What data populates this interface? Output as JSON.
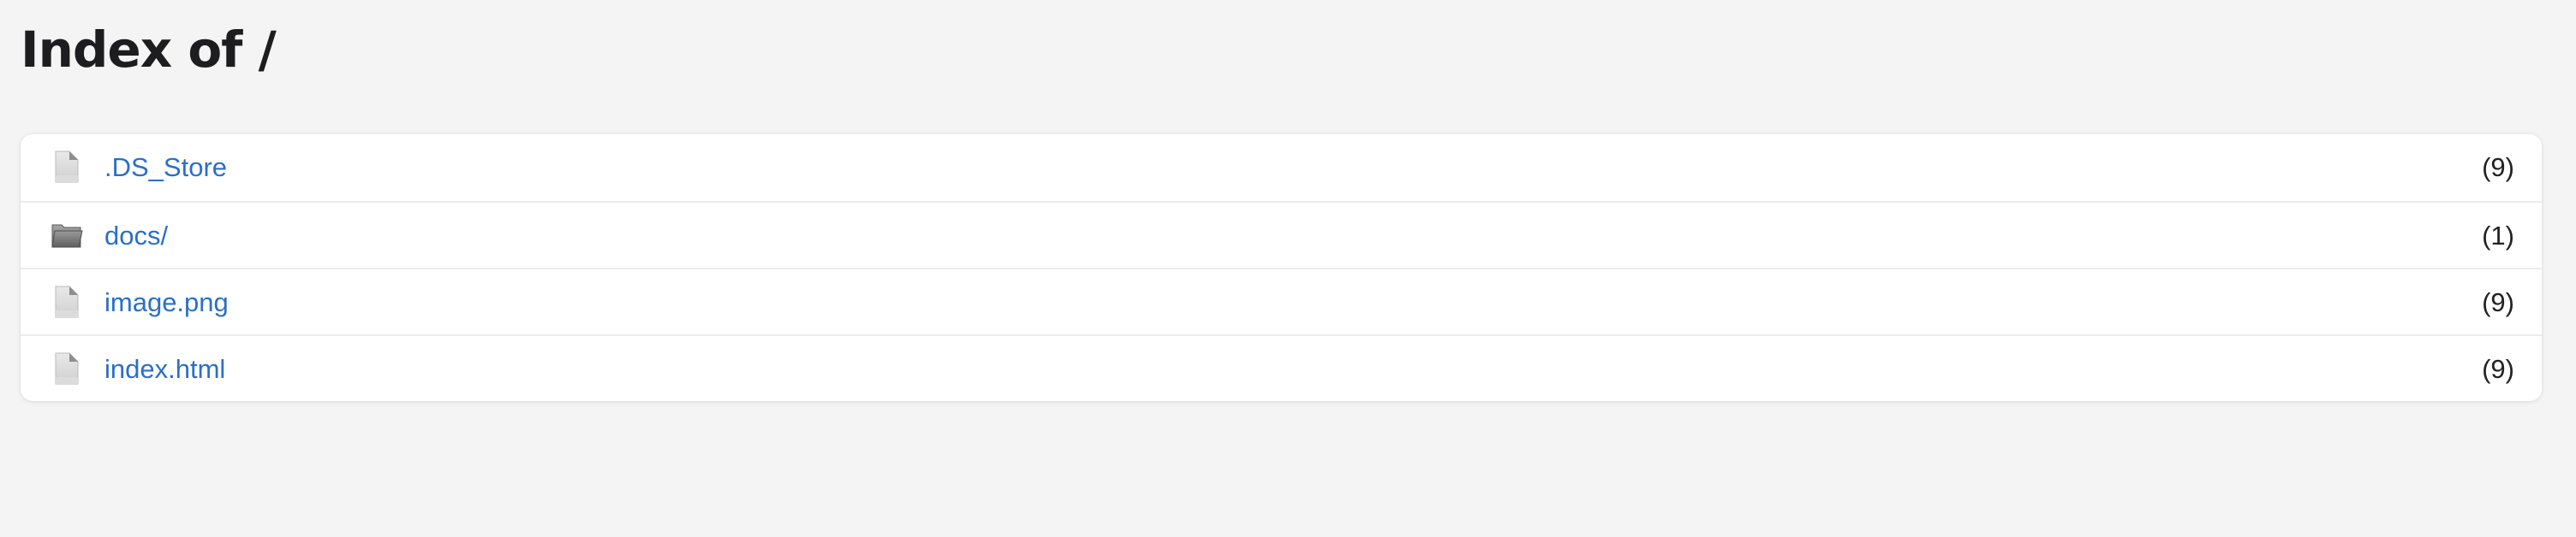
{
  "page": {
    "title": "Index of /"
  },
  "entries": [
    {
      "name": ".DS_Store",
      "type": "file",
      "count": "(9)",
      "icon": "file-icon"
    },
    {
      "name": "docs/",
      "type": "folder",
      "count": "(1)",
      "icon": "folder-icon"
    },
    {
      "name": "image.png",
      "type": "file",
      "count": "(9)",
      "icon": "file-icon"
    },
    {
      "name": "index.html",
      "type": "file",
      "count": "(9)",
      "icon": "file-icon"
    }
  ],
  "colors": {
    "background": "#f4f4f4",
    "card": "#ffffff",
    "link": "#2a6fc9",
    "text": "#222222"
  }
}
